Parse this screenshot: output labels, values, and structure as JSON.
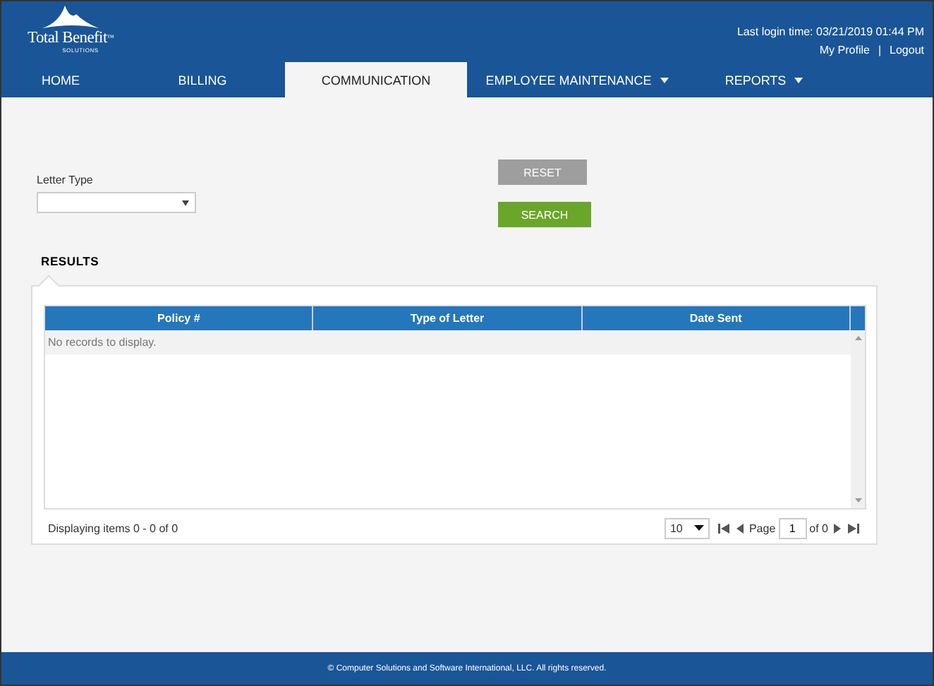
{
  "header": {
    "logo": {
      "name": "Total Benefit",
      "tm": "™",
      "tagline": "SOLUTIONS"
    },
    "last_login": "Last login time: 03/21/2019 01:44 PM",
    "links": [
      "My Profile",
      "Logout"
    ],
    "separator": "|"
  },
  "nav": [
    {
      "label": "HOME",
      "selected": false,
      "has_menu": false
    },
    {
      "label": "BILLING",
      "selected": false,
      "has_menu": false
    },
    {
      "label": "COMMUNICATION",
      "selected": true,
      "has_menu": false
    },
    {
      "label": "EMPLOYEE MAINTENANCE",
      "selected": false,
      "has_menu": true
    },
    {
      "label": "REPORTS",
      "selected": false,
      "has_menu": true
    }
  ],
  "form": {
    "letter_type_label": "Letter Type",
    "reset": "RESET",
    "search": "SEARCH"
  },
  "results": {
    "title": "RESULTS",
    "columns": [
      "Policy #",
      "Type of Letter",
      "Date Sent"
    ],
    "empty_message": "No records to display.",
    "pager": {
      "info": "Displaying items 0 - 0 of 0",
      "page_size": "10",
      "page_label": "Page",
      "page": "1",
      "of": "of 0"
    }
  },
  "footer": "©  Computer Solutions and Software International, LLC. All rights reserved."
}
